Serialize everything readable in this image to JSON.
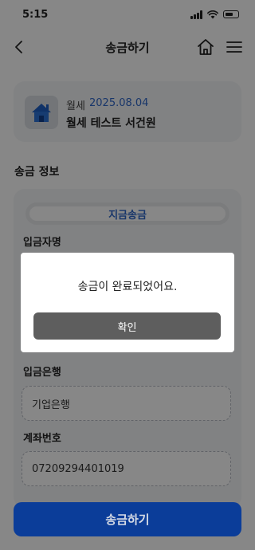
{
  "status_bar": {
    "time": "5:15"
  },
  "app_bar": {
    "title": "송금하기",
    "back_icon": "chevron-left-icon",
    "home_icon": "home-icon",
    "menu_icon": "hamburger-menu-icon"
  },
  "account_card": {
    "icon": "house-icon",
    "type": "월세",
    "date": "2025.08.04",
    "name": "월세 테스트 서건원"
  },
  "transfer_info": {
    "section_title": "송금 정보",
    "tab_label": "지금송금",
    "depositor_label": "입금자명",
    "bank_label": "입금은행",
    "bank_value": "기업은행",
    "account_label": "계좌번호",
    "account_value": "07209294401019"
  },
  "submit_button": {
    "label": "송금하기"
  },
  "modal": {
    "message": "송금이 완료되었어요.",
    "confirm_label": "확인"
  },
  "colors": {
    "accent": "#2f66c9",
    "primary_button": "#0b3d99",
    "confirm_button": "#5e5e5e",
    "overlay": "rgba(0,0,0,0.47)"
  }
}
